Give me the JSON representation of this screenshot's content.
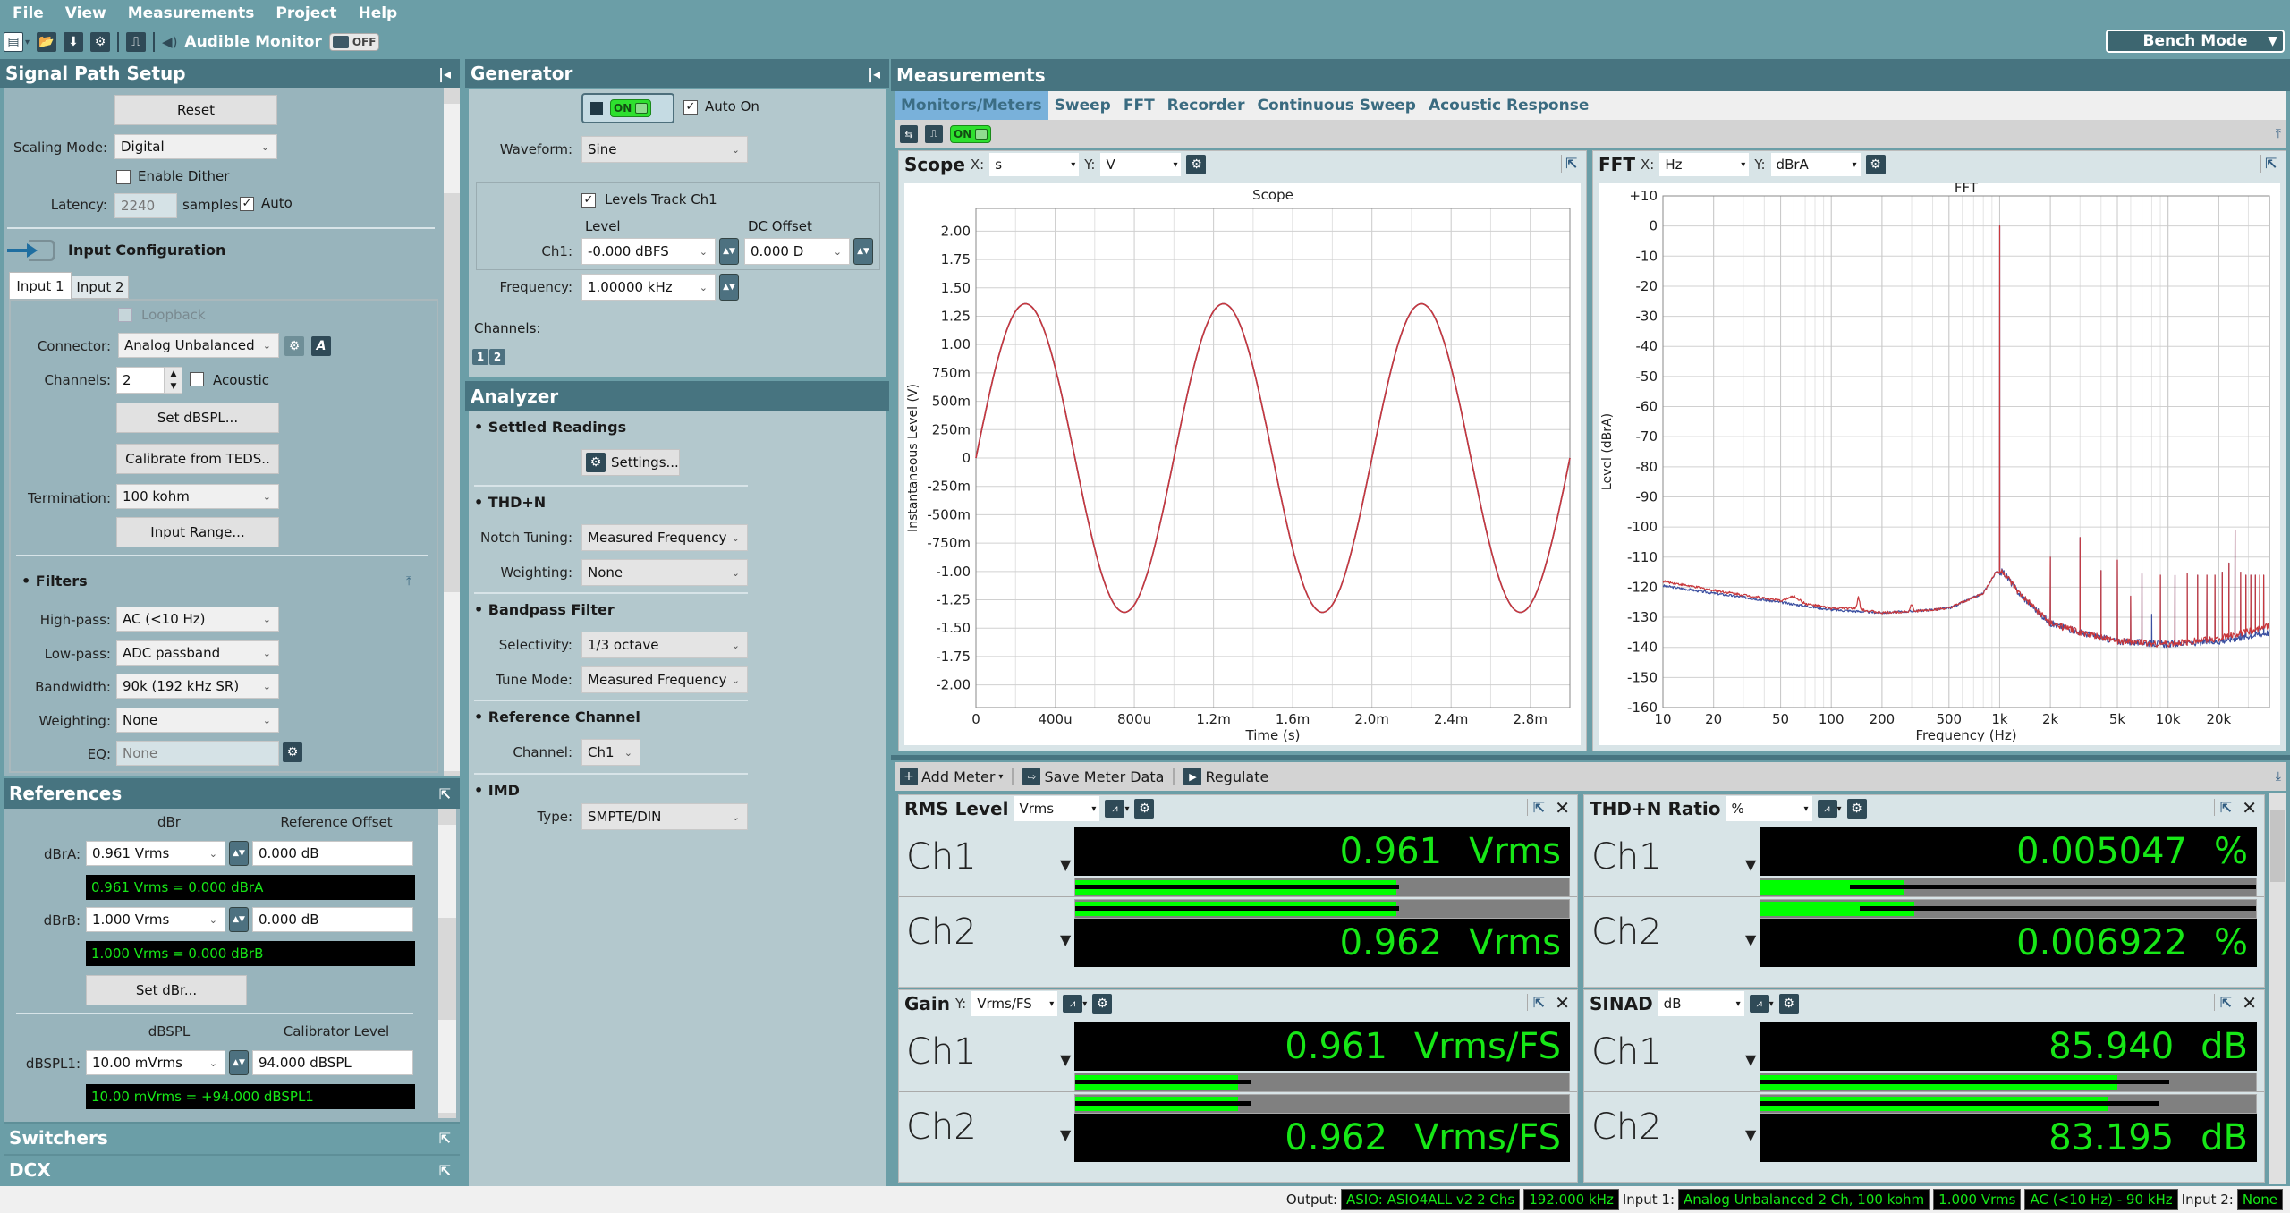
{
  "menu": [
    "File",
    "View",
    "Measurements",
    "Project",
    "Help"
  ],
  "toolbar": {
    "audible_monitor_label": "Audible Monitor",
    "audible_monitor_state": "OFF",
    "bench_mode": "Bench Mode"
  },
  "signal_path": {
    "title": "Signal Path Setup",
    "reset_label": "Reset",
    "scaling_mode_label": "Scaling Mode:",
    "scaling_mode_value": "Digital",
    "enable_dither_label": "Enable Dither",
    "enable_dither_checked": false,
    "latency_label": "Latency:",
    "latency_value": "2240",
    "latency_unit": "samples",
    "auto_label": "Auto",
    "auto_checked": true,
    "input_config_title": "Input Configuration",
    "tabs": [
      "Input 1",
      "Input 2"
    ],
    "active_tab": "Input 1",
    "loopback_label": "Loopback",
    "connector_label": "Connector:",
    "connector_value": "Analog Unbalanced",
    "channels_label": "Channels:",
    "channels_value": "2",
    "acoustic_label": "Acoustic",
    "set_dbspl_label": "Set dBSPL...",
    "calibrate_teds_label": "Calibrate from TEDS..",
    "termination_label": "Termination:",
    "termination_value": "100 kohm",
    "input_range_label": "Input Range...",
    "filters_title": "• Filters",
    "highpass_label": "High-pass:",
    "highpass_value": "AC (<10 Hz)",
    "lowpass_label": "Low-pass:",
    "lowpass_value": "ADC passband",
    "bandwidth_label": "Bandwidth:",
    "bandwidth_value": "90k (192 kHz SR)",
    "weighting_label": "Weighting:",
    "weighting_value": "None",
    "eq_label": "EQ:",
    "eq_value": "None"
  },
  "references": {
    "title": "References",
    "dbr_header": "dBr",
    "ref_offset_header": "Reference Offset",
    "dbra_label": "dBrA:",
    "dbra_value": "0.961 Vrms",
    "dbra_offset": "0.000 dB",
    "dbra_readout": "0.961 Vrms = 0.000 dBrA",
    "dbrb_label": "dBrB:",
    "dbrb_value": "1.000 Vrms",
    "dbrb_offset": "0.000 dB",
    "dbrb_readout": "1.000 Vrms = 0.000 dBrB",
    "set_dbr_label": "Set dBr...",
    "dbspl_header": "dBSPL",
    "calibrator_header": "Calibrator Level",
    "dbspl1_label": "dBSPL1:",
    "dbspl1_value": "10.00 mVrms",
    "dbspl1_cal": "94.000 dBSPL",
    "dbspl1_readout": "10.00 mVrms = +94.000 dBSPL1"
  },
  "switchers_title": "Switchers",
  "dcx_title": "DCX",
  "generator": {
    "title": "Generator",
    "state": "ON",
    "auto_on_label": "Auto On",
    "auto_on_checked": true,
    "waveform_label": "Waveform:",
    "waveform_value": "Sine",
    "levels_track_label": "Levels Track Ch1",
    "levels_track_checked": true,
    "level_header": "Level",
    "dc_offset_header": "DC Offset",
    "ch1_label": "Ch1:",
    "ch1_level": "-0.000 dBFS",
    "ch1_dc": "0.000 D",
    "frequency_label": "Frequency:",
    "frequency_value": "1.00000 kHz",
    "channels_label": "Channels:",
    "channel_buttons": [
      "1",
      "2"
    ]
  },
  "analyzer": {
    "title": "Analyzer",
    "settled_title": "• Settled Readings",
    "settings_label": "Settings...",
    "thdn_title": "• THD+N",
    "notch_label": "Notch Tuning:",
    "notch_value": "Measured Frequency",
    "weighting_label": "Weighting:",
    "weighting_value": "None",
    "bandpass_title": "• Bandpass Filter",
    "selectivity_label": "Selectivity:",
    "selectivity_value": "1/3 octave",
    "tune_mode_label": "Tune Mode:",
    "tune_mode_value": "Measured Frequency",
    "refch_title": "• Reference Channel",
    "channel_label": "Channel:",
    "channel_value": "Ch1",
    "imd_title": "• IMD",
    "type_label": "Type:",
    "type_value": "SMPTE/DIN"
  },
  "measurements": {
    "title": "Measurements",
    "tabs": [
      "Monitors/Meters",
      "Sweep",
      "FFT",
      "Recorder",
      "Continuous Sweep",
      "Acoustic Response"
    ],
    "active_tab": "Monitors/Meters",
    "monitor_state": "ON"
  },
  "scope_panel": {
    "title": "Scope",
    "x_label": "X:",
    "x_unit": "s",
    "y_label": "Y:",
    "y_unit": "V"
  },
  "fft_panel": {
    "title": "FFT",
    "x_label": "X:",
    "x_unit": "Hz",
    "y_label": "Y:",
    "y_unit": "dBrA"
  },
  "meter_toolbar": {
    "add_meter": "Add Meter",
    "save_meter_data": "Save Meter Data",
    "regulate": "Regulate"
  },
  "meters": [
    {
      "title": "RMS Level",
      "unit_select": "Vrms",
      "y_prefix": "",
      "channels": [
        {
          "name": "Ch1",
          "value": "0.961",
          "unit": "Vrms",
          "bar_fraction": 0.65,
          "peak_fraction": 0.655
        },
        {
          "name": "Ch2",
          "value": "0.962",
          "unit": "Vrms",
          "bar_fraction": 0.65,
          "peak_fraction": 0.655
        }
      ]
    },
    {
      "title": "THD+N Ratio",
      "unit_select": "%",
      "y_prefix": "",
      "channels": [
        {
          "name": "Ch1",
          "value": "0.005047",
          "unit": "%",
          "bar_fraction": 0.29,
          "peak_fraction": 0.18
        },
        {
          "name": "Ch2",
          "value": "0.006922",
          "unit": "%",
          "bar_fraction": 0.31,
          "peak_fraction": 0.2
        }
      ]
    },
    {
      "title": "Gain",
      "unit_select": "Vrms/FS",
      "y_prefix": "Y:",
      "channels": [
        {
          "name": "Ch1",
          "value": "0.961",
          "unit": "Vrms/FS",
          "bar_fraction": 0.33,
          "peak_fraction": 0.355
        },
        {
          "name": "Ch2",
          "value": "0.962",
          "unit": "Vrms/FS",
          "bar_fraction": 0.33,
          "peak_fraction": 0.355
        }
      ]
    },
    {
      "title": "SINAD",
      "unit_select": "dB",
      "y_prefix": "",
      "channels": [
        {
          "name": "Ch1",
          "value": "85.940",
          "unit": "dB",
          "bar_fraction": 0.72,
          "peak_fraction": 0.825
        },
        {
          "name": "Ch2",
          "value": "83.195",
          "unit": "dB",
          "bar_fraction": 0.7,
          "peak_fraction": 0.805
        }
      ]
    }
  ],
  "status": {
    "output_label": "Output:",
    "output_device": "ASIO: ASIO4ALL v2 2 Chs",
    "output_rate": "192.000 kHz",
    "input1_label": "Input 1:",
    "input1_conn": "Analog Unbalanced 2 Ch, 100 kohm",
    "input1_range": "1.000 Vrms",
    "input1_bw": "AC (<10 Hz) - 90 kHz",
    "input2_label": "Input 2:",
    "input2_value": "None"
  },
  "chart_data": [
    {
      "type": "line",
      "title": "Scope",
      "xlabel": "Time (s)",
      "ylabel": "Instantaneous Level (V)",
      "xlim": [
        0,
        0.003
      ],
      "ylim": [
        -2.2,
        2.2
      ],
      "x_ticks": [
        0,
        0.0004,
        0.0008,
        0.0012,
        0.0016,
        0.002,
        0.0024,
        0.0028
      ],
      "x_tick_labels": [
        "0",
        "400u",
        "800u",
        "1.2m",
        "1.6m",
        "2.0m",
        "2.4m",
        "2.8m"
      ],
      "y_ticks": [
        2,
        1.75,
        1.5,
        1.25,
        1,
        0.75,
        0.5,
        0.25,
        0,
        -0.25,
        -0.5,
        -0.75,
        -1,
        -1.25,
        -1.5,
        -1.75,
        -2
      ],
      "y_tick_labels": [
        "2.00",
        "1.75",
        "1.50",
        "1.25",
        "1.00",
        "750m",
        "500m",
        "250m",
        "0",
        "-250m",
        "-500m",
        "-750m",
        "-1.00",
        "-1.25",
        "-1.50",
        "-1.75",
        "-2.00"
      ],
      "grid": true,
      "series": [
        {
          "name": "Ch1",
          "color": "#3b4fa0",
          "waveform": "sine",
          "amplitude": 1.36,
          "frequency_hz": 1000,
          "phase_deg": 0
        },
        {
          "name": "Ch2",
          "color": "#c8383c",
          "waveform": "sine",
          "amplitude": 1.36,
          "frequency_hz": 1000,
          "phase_deg": 0
        }
      ]
    },
    {
      "type": "line",
      "title": "FFT",
      "xlabel": "Frequency (Hz)",
      "ylabel": "Level (dBrA)",
      "xscale": "log",
      "xlim": [
        10,
        40000
      ],
      "ylim": [
        -160,
        10
      ],
      "x_ticks": [
        10,
        20,
        50,
        100,
        200,
        500,
        1000,
        2000,
        5000,
        10000,
        20000
      ],
      "x_tick_labels": [
        "10",
        "20",
        "50",
        "100",
        "200",
        "500",
        "1k",
        "2k",
        "5k",
        "10k",
        "20k"
      ],
      "y_ticks": [
        10,
        0,
        -10,
        -20,
        -30,
        -40,
        -50,
        -60,
        -70,
        -80,
        -90,
        -100,
        -110,
        -120,
        -130,
        -140,
        -150,
        -160
      ],
      "y_tick_labels": [
        "+10",
        "0",
        "-10",
        "-20",
        "-30",
        "-40",
        "-50",
        "-60",
        "-70",
        "-80",
        "-90",
        "-100",
        "-110",
        "-120",
        "-130",
        "-140",
        "-150",
        "-160"
      ],
      "grid": true,
      "series": [
        {
          "name": "Ch1",
          "color": "#3b4fa0",
          "noise_floor": [
            [
              10,
              -119.5
            ],
            [
              20,
              -122
            ],
            [
              50,
              -125
            ],
            [
              100,
              -127.5
            ],
            [
              200,
              -128.5
            ],
            [
              300,
              -128
            ],
            [
              500,
              -127
            ],
            [
              800,
              -122
            ],
            [
              950,
              -115
            ],
            [
              1000,
              0
            ],
            [
              1050,
              -115
            ],
            [
              1300,
              -122
            ],
            [
              2000,
              -132
            ],
            [
              3000,
              -135
            ],
            [
              5000,
              -138
            ],
            [
              10000,
              -139
            ],
            [
              20000,
              -138
            ],
            [
              40000,
              -135
            ]
          ],
          "peaks": [
            [
              1000,
              0
            ],
            [
              2000,
              -110
            ],
            [
              3000,
              -103.5
            ],
            [
              4000,
              -114.5
            ],
            [
              5000,
              -111
            ],
            [
              6000,
              -123
            ],
            [
              7000,
              -115.5
            ],
            [
              8000,
              -129
            ],
            [
              9000,
              -116
            ],
            [
              11000,
              -116
            ],
            [
              13000,
              -115.5
            ],
            [
              15000,
              -116
            ],
            [
              17000,
              -116
            ],
            [
              19000,
              -116
            ],
            [
              21000,
              -115
            ],
            [
              23000,
              -112
            ],
            [
              25000,
              -101
            ],
            [
              27000,
              -115
            ],
            [
              29000,
              -116
            ],
            [
              31000,
              -116
            ],
            [
              33000,
              -116
            ],
            [
              35000,
              -116
            ],
            [
              37000,
              -116
            ]
          ]
        },
        {
          "name": "Ch2",
          "color": "#c8383c",
          "noise_floor": [
            [
              10,
              -118
            ],
            [
              20,
              -121
            ],
            [
              50,
              -124.5
            ],
            [
              60,
              -123
            ],
            [
              70,
              -125.5
            ],
            [
              100,
              -127
            ],
            [
              140,
              -127
            ],
            [
              145,
              -123
            ],
            [
              150,
              -127.5
            ],
            [
              200,
              -128.5
            ],
            [
              290,
              -128
            ],
            [
              300,
              -125.5
            ],
            [
              310,
              -128
            ],
            [
              500,
              -127
            ],
            [
              800,
              -122
            ],
            [
              950,
              -115
            ],
            [
              1000,
              0
            ],
            [
              1050,
              -115
            ],
            [
              1300,
              -122
            ],
            [
              2000,
              -132
            ],
            [
              3000,
              -135
            ],
            [
              5000,
              -138
            ],
            [
              10000,
              -139
            ],
            [
              20000,
              -137
            ],
            [
              40000,
              -133
            ]
          ],
          "peaks": [
            [
              1000,
              0
            ],
            [
              2000,
              -110
            ],
            [
              3000,
              -103.5
            ],
            [
              4000,
              -114.5
            ],
            [
              5000,
              -111
            ],
            [
              6000,
              -123
            ],
            [
              7000,
              -115.5
            ],
            [
              9000,
              -116
            ],
            [
              11000,
              -116
            ],
            [
              13000,
              -115.5
            ],
            [
              15000,
              -116
            ],
            [
              17000,
              -116
            ],
            [
              19000,
              -116
            ],
            [
              21000,
              -115
            ],
            [
              23000,
              -112
            ],
            [
              25000,
              -101
            ],
            [
              27000,
              -115
            ],
            [
              29000,
              -116
            ],
            [
              31000,
              -116
            ],
            [
              33000,
              -116
            ],
            [
              35000,
              -116
            ],
            [
              37000,
              -116
            ]
          ]
        }
      ]
    }
  ]
}
